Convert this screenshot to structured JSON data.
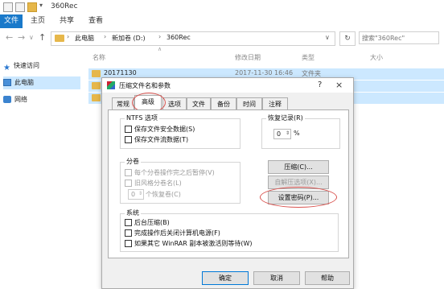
{
  "window": {
    "title": "360Rec"
  },
  "ribbon": {
    "tabs": [
      "文件",
      "主页",
      "共享",
      "查看"
    ]
  },
  "address": {
    "crumbs": [
      "此电脑",
      "新加卷 (D:)",
      "360Rec"
    ],
    "search_placeholder": "搜索\"360Rec\""
  },
  "nav": {
    "items": [
      "快速访问",
      "此电脑",
      "网络"
    ]
  },
  "filelist": {
    "headers": {
      "name": "名称",
      "date": "修改日期",
      "type": "类型",
      "size": "大小"
    },
    "rows": [
      {
        "name": "20171130",
        "date": "2017-11-30 16:46",
        "type": "文件夹"
      },
      {
        "name": "2",
        "date": "",
        "type": ""
      },
      {
        "name": "2",
        "date": "",
        "type": ""
      }
    ]
  },
  "dialog": {
    "title": "压缩文件名和参数",
    "help": "?",
    "close": "×",
    "tabs": [
      "常规",
      "高级",
      "选项",
      "文件",
      "备份",
      "时间",
      "注释"
    ],
    "active_tab": "高级",
    "ntfs": {
      "label": "NTFS 选项",
      "options": [
        "保存文件安全数据(S)",
        "保存文件流数据(T)"
      ]
    },
    "recovery": {
      "label": "恢复记录(R)",
      "value": "0",
      "unit": "%"
    },
    "volume": {
      "label": "分卷",
      "options": [
        "每个分卷操作完之后暂停(V)",
        "旧风格分卷名(L)"
      ],
      "spin_value": "0",
      "spin_label": "个恢复卷(C)"
    },
    "buttons": {
      "compress": "压缩(C)...",
      "sfx": "自解压选项(X)...",
      "password": "设置密码(P)..."
    },
    "system": {
      "label": "系统",
      "options": [
        "后台压缩(B)",
        "完成操作后关闭计算机电源(F)",
        "如果其它 WinRAR 副本被激活则等待(W)"
      ]
    },
    "footer": {
      "ok": "确定",
      "cancel": "取消",
      "help": "帮助"
    }
  },
  "colors": {
    "accent": "#1979ca",
    "selection": "#cce8ff",
    "annotation": "#d9534f",
    "folder": "#e6b74a"
  }
}
